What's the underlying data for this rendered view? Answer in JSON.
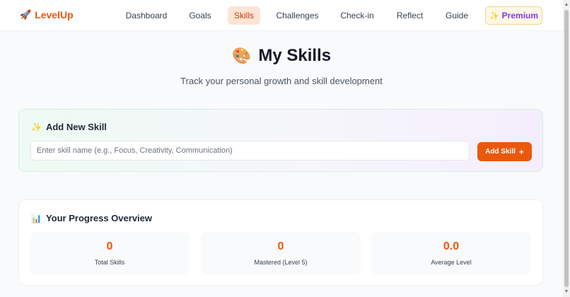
{
  "nav": {
    "logo_icon": "🚀",
    "logo": "LevelUp",
    "items": [
      {
        "label": "Dashboard",
        "active": false
      },
      {
        "label": "Goals",
        "active": false
      },
      {
        "label": "Skills",
        "active": true
      },
      {
        "label": "Challenges",
        "active": false
      },
      {
        "label": "Check-in",
        "active": false
      },
      {
        "label": "Reflect",
        "active": false
      },
      {
        "label": "Guide",
        "active": false
      }
    ],
    "premium_icon": "✨",
    "premium": "Premium"
  },
  "hero": {
    "icon": "🎨",
    "title": "My Skills",
    "subtitle": "Track your personal growth and skill development"
  },
  "add_skill": {
    "icon": "✨",
    "heading": "Add New Skill",
    "input_value": "",
    "placeholder": "Enter skill name (e.g., Focus, Creativity, Communication)",
    "button_label": "Add Skill",
    "button_icon": "+"
  },
  "progress": {
    "icon": "📊",
    "heading": "Your Progress Overview",
    "stats": [
      {
        "value": "0",
        "label": "Total Skills"
      },
      {
        "value": "0",
        "label": "Mastered (Level 5)"
      },
      {
        "value": "0.0",
        "label": "Average Level"
      }
    ]
  },
  "colors": {
    "accent": "#ea580c",
    "active_tab_bg": "#fde4d6",
    "premium_text": "#7c3aed"
  }
}
